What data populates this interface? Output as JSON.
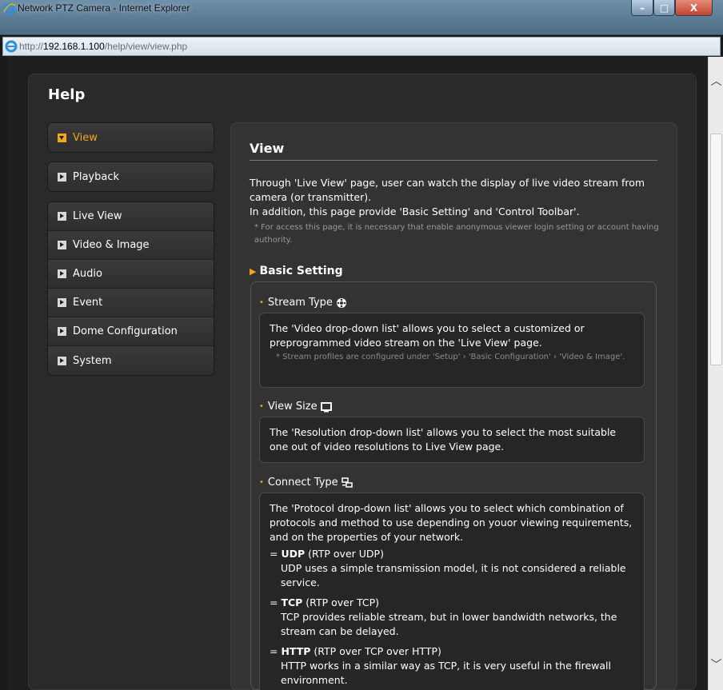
{
  "window": {
    "title": "Network PTZ Camera - Internet Explorer",
    "min": "–",
    "max": "□",
    "close": "X"
  },
  "address": {
    "prefix": "http://",
    "host": "192.168.1.100",
    "path": "/help/view/view.php"
  },
  "help": {
    "title": "Help"
  },
  "sidebar": {
    "group1": [
      {
        "label": "View",
        "active": true
      }
    ],
    "group2": [
      {
        "label": "Playback"
      }
    ],
    "group3": [
      {
        "label": "Live View"
      },
      {
        "label": "Video & Image"
      },
      {
        "label": "Audio"
      },
      {
        "label": "Event"
      },
      {
        "label": "Dome Configuration"
      },
      {
        "label": "System"
      }
    ]
  },
  "content": {
    "title": "View",
    "intro1": "Through 'Live View' page, user can watch the display of live video stream from camera (or transmitter).",
    "intro2": "In addition, this page provide 'Basic Setting' and 'Control Toolbar'.",
    "intro_note": "* For access this page, it is necessary that enable anonymous viewer login setting or account having authority.",
    "section": "Basic Setting",
    "stream": {
      "head": "Stream Type",
      "text": "The 'Video drop-down list' allows you to select a customized or preprogrammed video stream on the 'Live View' page.",
      "note": "* Stream profiles are configured under 'Setup' › 'Basic Configuration' › 'Video & Image'."
    },
    "viewsize": {
      "head": "View Size",
      "text": "The 'Resolution drop-down list' allows you to select the most suitable one out of video resolutions to Live View page."
    },
    "connect": {
      "head": "Connect Type",
      "text": "The 'Protocol drop-down list' allows you to select which combination of protocols and method to use depending on youor viewing requirements, and on the properties of your network.",
      "udp_name": "UDP",
      "udp_sub": " (RTP over UDP)",
      "udp_desc": "UDP uses a simple transmission model, it is not considered a reliable service.",
      "tcp_name": "TCP",
      "tcp_sub": " (RTP over TCP)",
      "tcp_desc": "TCP provides reliable stream, but in lower bandwidth networks, the stream can be delayed.",
      "http_name": "HTTP",
      "http_sub": " (RTP over TCP over HTTP)",
      "http_desc": "HTTP works in a similar way as TCP, it is very useful in the firewall environment."
    }
  }
}
